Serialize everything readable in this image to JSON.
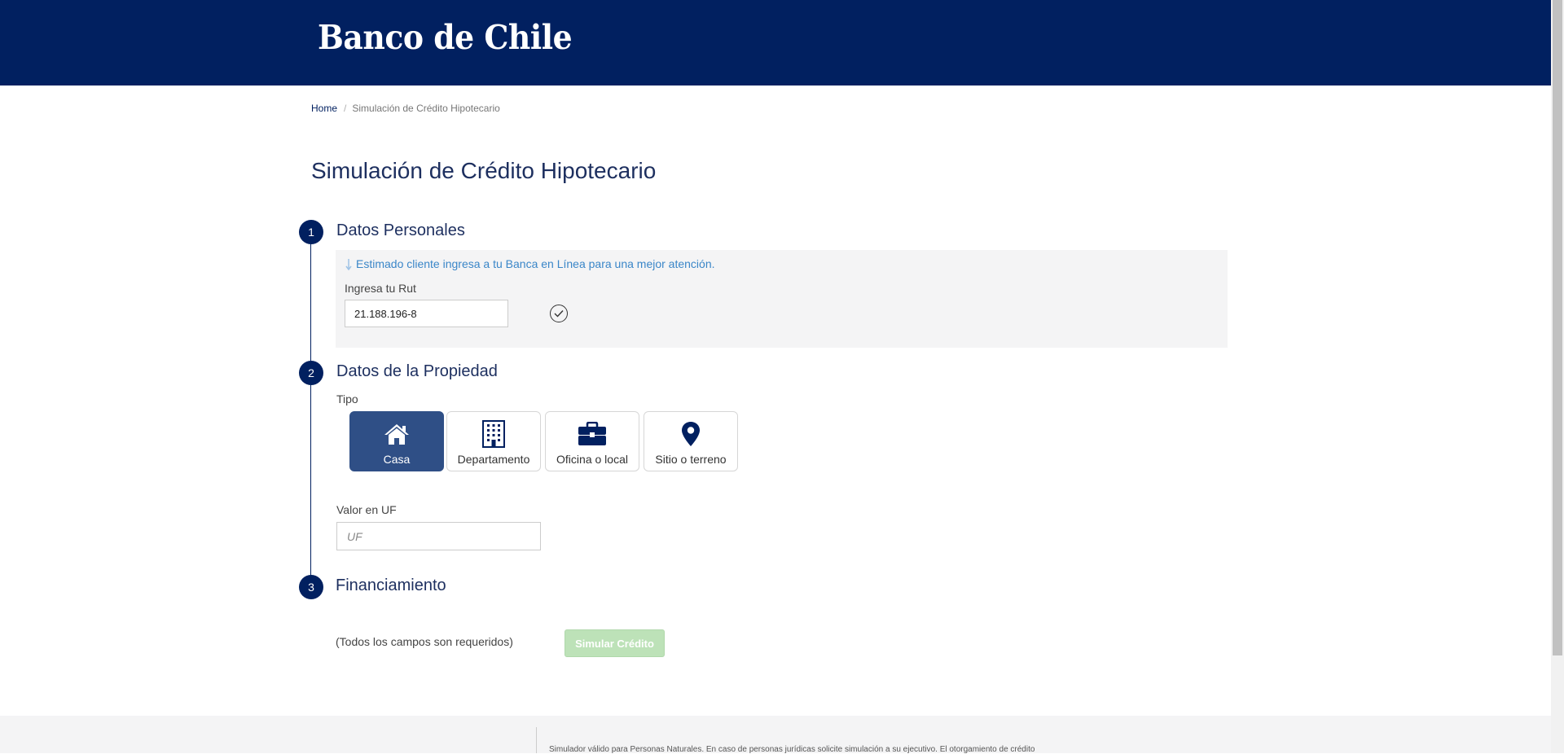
{
  "header": {
    "logo_text": "Banco de Chile",
    "background": "#012060"
  },
  "breadcrumb": {
    "home": "Home",
    "separator": "/",
    "current": "Simulación de Crédito Hipotecario"
  },
  "page_title": "Simulación de Crédito Hipotecario",
  "steps": [
    {
      "number": "1",
      "title": "Datos Personales"
    },
    {
      "number": "2",
      "title": "Datos de la Propiedad"
    },
    {
      "number": "3",
      "title": "Financiamiento"
    }
  ],
  "personal": {
    "notice": "Estimado cliente ingresa a tu Banca en Línea para una mejor atención.",
    "rut_label": "Ingresa tu Rut",
    "rut_value": "21.188.196-8",
    "rut_valid_icon": "check-circle-icon"
  },
  "property": {
    "type_label": "Tipo",
    "types": [
      {
        "label": "Casa",
        "icon": "house-icon",
        "selected": true
      },
      {
        "label": "Departamento",
        "icon": "building-icon",
        "selected": false
      },
      {
        "label": "Oficina o local",
        "icon": "briefcase-icon",
        "selected": false
      },
      {
        "label": "Sitio o terreno",
        "icon": "map-pin-icon",
        "selected": false
      }
    ],
    "value_label": "Valor en UF",
    "value_placeholder": "UF",
    "value": ""
  },
  "form": {
    "required_note": "(Todos los campos son requeridos)",
    "submit_label": "Simular Crédito",
    "submit_enabled": false
  },
  "footer": {
    "text": "Simulador válido para Personas Naturales. En caso de personas jurídicas solicite simulación a su ejecutivo. El otorgamiento de crédito"
  },
  "colors": {
    "primary": "#012060",
    "selected_card": "#2f4f86",
    "notice": "#3a86c8",
    "submit_disabled": "#bde2b8"
  }
}
